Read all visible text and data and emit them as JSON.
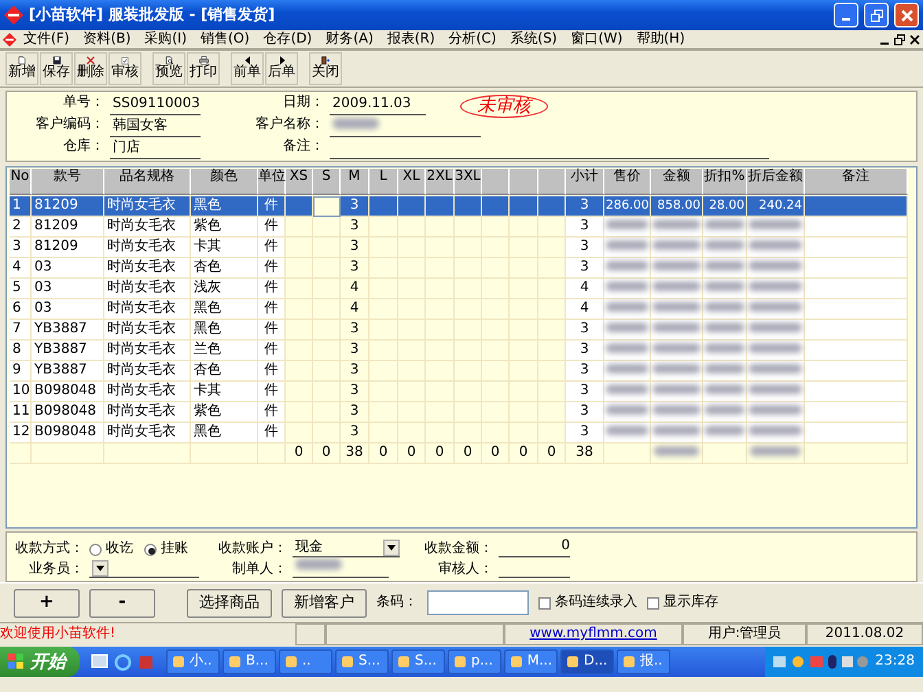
{
  "window": {
    "title": "[小苗软件] 服装批发版 - [销售发货]"
  },
  "menu": [
    "文件(F)",
    "资料(B)",
    "采购(I)",
    "销售(O)",
    "仓存(D)",
    "财务(A)",
    "报表(R)",
    "分析(C)",
    "系统(S)",
    "窗口(W)",
    "帮助(H)"
  ],
  "toolbar": [
    [
      {
        "label": "新增",
        "kind": "new"
      },
      {
        "label": "保存",
        "kind": "save"
      },
      {
        "label": "删除",
        "kind": "delete"
      },
      {
        "label": "审核",
        "kind": "audit"
      }
    ],
    [
      {
        "label": "预览",
        "kind": "preview"
      },
      {
        "label": "打印",
        "kind": "print"
      }
    ],
    [
      {
        "label": "前单",
        "kind": "prev"
      },
      {
        "label": "后单",
        "kind": "next"
      }
    ],
    [
      {
        "label": "关闭",
        "kind": "close"
      }
    ]
  ],
  "header": {
    "order_no_label": "单号：",
    "order_no": "SS09110003",
    "date_label": "日期：",
    "date": "2009.11.03",
    "customer_code_label": "客户编码：",
    "customer_code": "韩国女客",
    "customer_name_label": "客户名称：",
    "customer_name": {
      "kind": "blurred"
    },
    "warehouse_label": "仓库：",
    "warehouse": "门店",
    "remark_label": "备注：",
    "status_stamp": "未审核"
  },
  "table": {
    "columns": [
      {
        "label": "No",
        "kind": "text"
      },
      {
        "label": "款号",
        "kind": "text"
      },
      {
        "label": "品名规格",
        "kind": "text"
      },
      {
        "label": "颜色",
        "kind": "text"
      },
      {
        "label": "单位",
        "kind": "center"
      },
      {
        "label": "XS",
        "kind": "size"
      },
      {
        "label": "S",
        "kind": "size"
      },
      {
        "label": "M",
        "kind": "size"
      },
      {
        "label": "L",
        "kind": "size"
      },
      {
        "label": "XL",
        "kind": "size"
      },
      {
        "label": "2XL",
        "kind": "size"
      },
      {
        "label": "3XL",
        "kind": "size"
      },
      {
        "kind": "size"
      },
      {
        "kind": "size"
      },
      {
        "kind": "size"
      },
      {
        "label": "小计",
        "kind": "center"
      },
      {
        "label": "售价",
        "kind": "num"
      },
      {
        "label": "金额",
        "kind": "num"
      },
      {
        "label": "折扣%",
        "kind": "num"
      },
      {
        "label": "折后金额",
        "kind": "num"
      },
      {
        "label": "备注",
        "kind": "text"
      }
    ],
    "rows": [
      {
        "selected": true,
        "cells": [
          "1",
          "81209",
          "时尚女毛衣",
          "黑色",
          "件",
          null,
          {
            "kind": "editing"
          },
          "3",
          null,
          null,
          null,
          null,
          null,
          null,
          null,
          "3",
          "286.00",
          "858.00",
          "28.00",
          "240.24",
          null
        ]
      },
      {
        "selected": false,
        "cells": [
          "2",
          "81209",
          "时尚女毛衣",
          "紫色",
          "件",
          null,
          null,
          "3",
          null,
          null,
          null,
          null,
          null,
          null,
          null,
          "3",
          {
            "kind": "blurred"
          },
          {
            "kind": "blurred"
          },
          {
            "kind": "blurred"
          },
          {
            "kind": "blurred"
          },
          null
        ]
      },
      {
        "selected": false,
        "cells": [
          "3",
          "81209",
          "时尚女毛衣",
          "卡其",
          "件",
          null,
          null,
          "3",
          null,
          null,
          null,
          null,
          null,
          null,
          null,
          "3",
          {
            "kind": "blurred"
          },
          {
            "kind": "blurred"
          },
          {
            "kind": "blurred"
          },
          {
            "kind": "blurred"
          },
          null
        ]
      },
      {
        "selected": false,
        "cells": [
          "4",
          "03",
          "时尚女毛衣",
          "杏色",
          "件",
          null,
          null,
          "3",
          null,
          null,
          null,
          null,
          null,
          null,
          null,
          "3",
          {
            "kind": "blurred"
          },
          {
            "kind": "blurred"
          },
          {
            "kind": "blurred"
          },
          {
            "kind": "blurred"
          },
          null
        ]
      },
      {
        "selected": false,
        "cells": [
          "5",
          "03",
          "时尚女毛衣",
          "浅灰",
          "件",
          null,
          null,
          "4",
          null,
          null,
          null,
          null,
          null,
          null,
          null,
          "4",
          {
            "kind": "blurred"
          },
          {
            "kind": "blurred"
          },
          {
            "kind": "blurred"
          },
          {
            "kind": "blurred"
          },
          null
        ]
      },
      {
        "selected": false,
        "cells": [
          "6",
          "03",
          "时尚女毛衣",
          "黑色",
          "件",
          null,
          null,
          "4",
          null,
          null,
          null,
          null,
          null,
          null,
          null,
          "4",
          {
            "kind": "blurred"
          },
          {
            "kind": "blurred"
          },
          {
            "kind": "blurred"
          },
          {
            "kind": "blurred"
          },
          null
        ]
      },
      {
        "selected": false,
        "cells": [
          "7",
          "YB3887",
          "时尚女毛衣",
          "黑色",
          "件",
          null,
          null,
          "3",
          null,
          null,
          null,
          null,
          null,
          null,
          null,
          "3",
          {
            "kind": "blurred"
          },
          {
            "kind": "blurred"
          },
          {
            "kind": "blurred"
          },
          {
            "kind": "blurred"
          },
          null
        ]
      },
      {
        "selected": false,
        "cells": [
          "8",
          "YB3887",
          "时尚女毛衣",
          "兰色",
          "件",
          null,
          null,
          "3",
          null,
          null,
          null,
          null,
          null,
          null,
          null,
          "3",
          {
            "kind": "blurred"
          },
          {
            "kind": "blurred"
          },
          {
            "kind": "blurred"
          },
          {
            "kind": "blurred"
          },
          null
        ]
      },
      {
        "selected": false,
        "cells": [
          "9",
          "YB3887",
          "时尚女毛衣",
          "杏色",
          "件",
          null,
          null,
          "3",
          null,
          null,
          null,
          null,
          null,
          null,
          null,
          "3",
          {
            "kind": "blurred"
          },
          {
            "kind": "blurred"
          },
          {
            "kind": "blurred"
          },
          {
            "kind": "blurred"
          },
          null
        ]
      },
      {
        "selected": false,
        "cells": [
          "10",
          "B098048",
          "时尚女毛衣",
          "卡其",
          "件",
          null,
          null,
          "3",
          null,
          null,
          null,
          null,
          null,
          null,
          null,
          "3",
          {
            "kind": "blurred"
          },
          {
            "kind": "blurred"
          },
          {
            "kind": "blurred"
          },
          {
            "kind": "blurred"
          },
          null
        ]
      },
      {
        "selected": false,
        "cells": [
          "11",
          "B098048",
          "时尚女毛衣",
          "紫色",
          "件",
          null,
          null,
          "3",
          null,
          null,
          null,
          null,
          null,
          null,
          null,
          "3",
          {
            "kind": "blurred"
          },
          {
            "kind": "blurred"
          },
          {
            "kind": "blurred"
          },
          {
            "kind": "blurred"
          },
          null
        ]
      },
      {
        "selected": false,
        "cells": [
          "12",
          "B098048",
          "时尚女毛衣",
          "黑色",
          "件",
          null,
          null,
          "3",
          null,
          null,
          null,
          null,
          null,
          null,
          null,
          "3",
          {
            "kind": "blurred"
          },
          {
            "kind": "blurred"
          },
          {
            "kind": "blurred"
          },
          {
            "kind": "blurred"
          },
          null
        ]
      }
    ],
    "totals": {
      "sizes": [
        "0",
        "0",
        "38",
        "0",
        "0",
        "0",
        "0",
        "0",
        "0",
        "0"
      ],
      "subtotal": "38",
      "amount": {
        "kind": "blurred"
      },
      "discounted_amount": {
        "kind": "blurred"
      }
    }
  },
  "payment": {
    "method_label": "收款方式：",
    "methods": [
      {
        "label": "收讫",
        "selected": false
      },
      {
        "label": "挂账",
        "selected": true
      }
    ],
    "account_label": "收款账户：",
    "account": "现金",
    "amount_label": "收款金额：",
    "amount": "0",
    "salesman_label": "业务员：",
    "maker_label": "制单人：",
    "maker": {
      "kind": "blurred"
    },
    "auditor_label": "审核人："
  },
  "actions": {
    "buttons": [
      "+",
      "-",
      "选择商品",
      "新增客户"
    ],
    "barcode_label": "条码：",
    "checkboxes": [
      {
        "label": "条码连续录入",
        "checked": false
      },
      {
        "label": "显示库存",
        "checked": false
      }
    ]
  },
  "status_bar": {
    "message": "欢迎使用小苗软件!",
    "link": "www.myflmm.com",
    "user": "用户:管理员",
    "date": "2011.08.02"
  },
  "taskbar": {
    "start": "开始",
    "tasks": [
      {
        "label": "小..",
        "active": false
      },
      {
        "label": "B...",
        "active": false
      },
      {
        "label": "..",
        "active": false
      },
      {
        "label": "S...",
        "active": false
      },
      {
        "label": "S...",
        "active": false
      },
      {
        "label": "p...",
        "active": false
      },
      {
        "label": "M...",
        "active": false
      },
      {
        "label": "D...",
        "active": true
      },
      {
        "label": "报..",
        "active": false
      }
    ],
    "time": "23:28"
  }
}
